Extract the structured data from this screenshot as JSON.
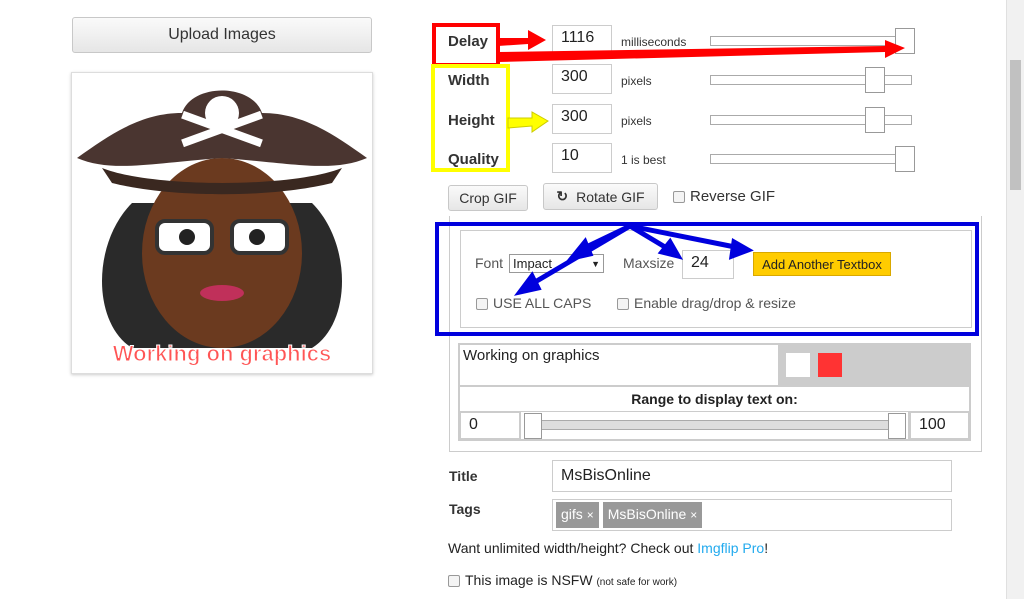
{
  "upload_label": "Upload Images",
  "preview": {
    "caption": "Working on graphics"
  },
  "settings": [
    {
      "label": "Delay",
      "value": "1116",
      "unit": "milliseconds",
      "slider_percent": 98
    },
    {
      "label": "Width",
      "value": "300",
      "unit": "pixels",
      "slider_percent": 82
    },
    {
      "label": "Height",
      "value": "300",
      "unit": "pixels",
      "slider_percent": 82
    },
    {
      "label": "Quality",
      "value": "10",
      "unit": "1 is best",
      "slider_percent": 98
    }
  ],
  "crop_label": "Crop GIF",
  "rotate_label": "Rotate GIF",
  "reverse_label": "Reverse GIF",
  "text_opts": {
    "font_label": "Font",
    "font_value": "Impact",
    "maxsize_label": "Maxsize",
    "maxsize_value": "24",
    "add_label": "Add Another Textbox",
    "caps_label": "USE ALL CAPS",
    "drag_label": "Enable drag/drop & resize"
  },
  "textbox": {
    "text": "Working on graphics",
    "color1": "#ffffff",
    "color2": "#ff3333",
    "range_label": "Range to display text on:",
    "range_min": "0",
    "range_max": "100"
  },
  "title_label": "Title",
  "title_value": "MsBisOnline",
  "tags_label": "Tags",
  "tags": [
    "gifs",
    "MsBisOnline"
  ],
  "pro_text": "Want unlimited width/height? Check out ",
  "pro_link": "Imgflip Pro",
  "pro_end": "!",
  "nsfw_label": "This image is NSFW",
  "nsfw_note": "(not safe for work)",
  "colors": {
    "annot_red": "#ff0000",
    "annot_yellow": "#ffff00",
    "annot_blue": "#0000dd",
    "add_btn": "#ffcc00",
    "link": "#22aaee"
  }
}
